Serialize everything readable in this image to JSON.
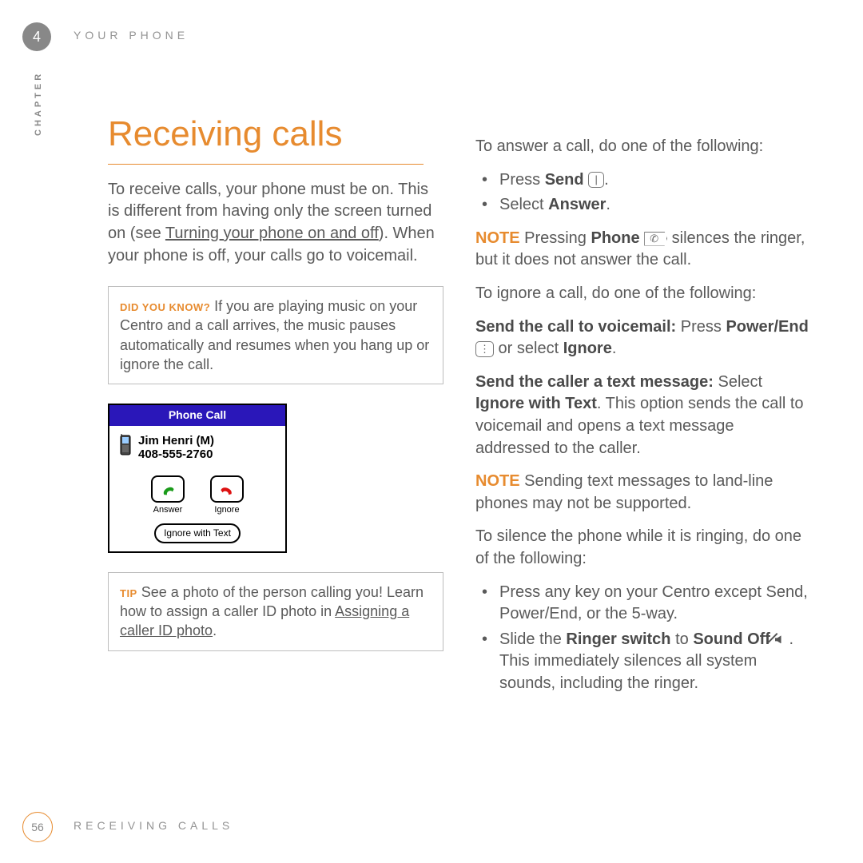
{
  "header": {
    "chapter_num": "4",
    "chapter_title": "YOUR PHONE",
    "side_label": "CHAPTER"
  },
  "footer": {
    "page_num": "56",
    "section": "RECEIVING CALLS"
  },
  "left": {
    "title": "Receiving calls",
    "intro_a": "To receive calls, your phone must be on. This is different from having only the screen turned on (see ",
    "intro_link": "Turning your phone on and off",
    "intro_b": "). When your phone is off, your calls go to voicemail.",
    "dyk_label": "DID YOU KNOW?",
    "dyk_text": " If you are playing music on your Centro and a call arrives, the music pauses automatically and resumes when you hang up or ignore the call.",
    "tip_label": "TIP",
    "tip_a": " See a photo of the person calling you! Learn how to assign a caller ID photo in ",
    "tip_link": "Assigning a caller ID photo",
    "tip_b": "."
  },
  "phone": {
    "title": "Phone Call",
    "caller_name": "Jim Henri (M)",
    "caller_number": "408-555-2760",
    "answer": "Answer",
    "ignore": "Ignore",
    "ignore_text": "Ignore with Text"
  },
  "right": {
    "answer_intro": "To answer a call, do one of the following:",
    "li1a": "Press ",
    "li1b": "Send",
    "li1c": " ",
    "li1d": ".",
    "li2a": "Select ",
    "li2b": "Answer",
    "li2c": ".",
    "note1_label": "NOTE",
    "note1_a": " Pressing ",
    "note1_b": "Phone",
    "note1_c": " ",
    "note1_d": " silences the ringer, but it does not answer the call.",
    "ignore_intro": "To ignore a call, do one of the following:",
    "vm_a": "Send the call to voicemail:",
    "vm_b": " Press ",
    "vm_c": "Power/End",
    "vm_d": " ",
    "vm_e": " or select ",
    "vm_f": "Ignore",
    "vm_g": ".",
    "tx_a": "Send the caller a text message:",
    "tx_b": " Select ",
    "tx_c": "Ignore with Text",
    "tx_d": ". This option sends the call to voicemail and opens a text message addressed to the caller.",
    "note2_label": "NOTE",
    "note2_a": " Sending text messages to land-line phones may not be supported.",
    "silence_intro": "To silence the phone while it is ringing, do one of the following:",
    "s1": "Press any key on your Centro except Send, Power/End, or the 5-way.",
    "s2a": "Slide the ",
    "s2b": "Ringer switch",
    "s2c": " to ",
    "s2d": "Sound Off",
    "s2e": " ",
    "s2f": ". This immediately silences all system sounds, including the ringer."
  },
  "icons": {
    "send_key": "|",
    "end_key": "⋮",
    "phone_key": "✆"
  }
}
